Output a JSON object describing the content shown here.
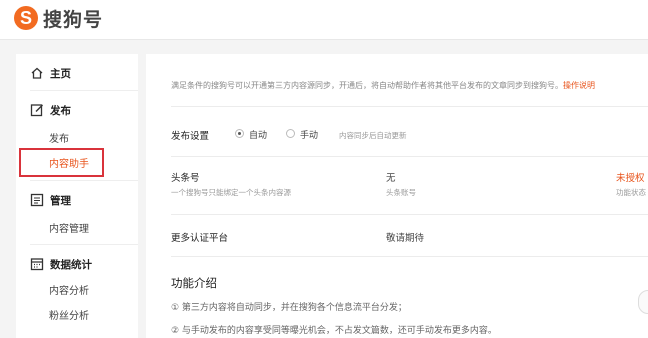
{
  "brand": {
    "name": "搜狗号",
    "logo_letter": "S",
    "accent": "#f26b21"
  },
  "sidebar": {
    "sections": [
      {
        "icon": "home-icon",
        "label": "主页",
        "items": []
      },
      {
        "icon": "edit-icon",
        "label": "发布",
        "items": [
          {
            "label": "发布"
          },
          {
            "label": "内容助手",
            "active": true
          }
        ]
      },
      {
        "icon": "document-icon",
        "label": "管理",
        "items": [
          {
            "label": "内容管理"
          }
        ]
      },
      {
        "icon": "calendar-icon",
        "label": "数据统计",
        "items": [
          {
            "label": "内容分析"
          },
          {
            "label": "粉丝分析"
          }
        ]
      }
    ]
  },
  "main": {
    "notice": "满足条件的搜狗号可以开通第三方内容源同步，开通后，将自动帮助作者将其他平台发布的文章同步到搜狗号。",
    "notice_link": "操作说明",
    "publish_settings": {
      "label": "发布设置",
      "options": [
        {
          "label": "自动",
          "checked": true
        },
        {
          "label": "手动",
          "checked": false
        }
      ],
      "hint": "内容同步后自动更新"
    },
    "toutiao": {
      "title": "头条号",
      "subtitle": "一个搜狗号只能绑定一个头条内容源",
      "value": "无",
      "value_sub": "头条账号",
      "status": "未授权",
      "status_sub": "功能状态"
    },
    "more_platforms": {
      "title": "更多认证平台",
      "value": "敬请期待"
    },
    "features": {
      "title": "功能介绍",
      "items": [
        "① 第三方内容将自动同步，并在搜狗各个信息流平台分发；",
        "② 与手动发布的内容享受同等曝光机会，不占发文篇数，还可手动发布更多内容。"
      ]
    }
  }
}
